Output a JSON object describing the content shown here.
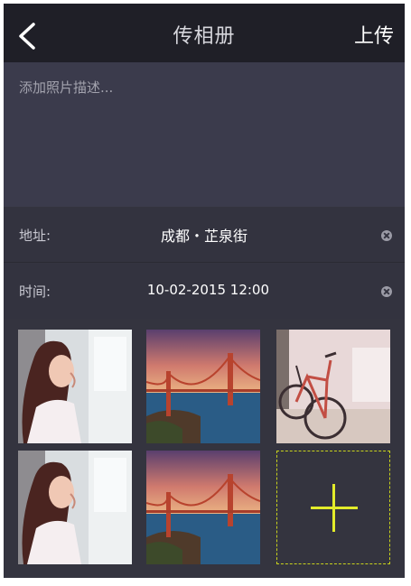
{
  "header": {
    "title": "传相册",
    "upload_label": "上传",
    "back_icon": "back-chevron-icon"
  },
  "description": {
    "placeholder": "添加照片描述..."
  },
  "fields": {
    "address": {
      "label": "地址:",
      "value": "成都・芷泉街",
      "clear_icon": "clear-icon"
    },
    "time": {
      "label": "时间:",
      "value": "10-02-2015  12:00",
      "clear_icon": "clear-icon"
    }
  },
  "photos": [
    {
      "subject": "woman portrait"
    },
    {
      "subject": "golden gate bridge"
    },
    {
      "subject": "bicycle"
    },
    {
      "subject": "woman portrait"
    },
    {
      "subject": "golden gate bridge"
    }
  ],
  "add_photo": {
    "icon": "plus-icon",
    "accent": "#e3ec2a"
  },
  "colors": {
    "header_bg": "#1f1f27",
    "body_bg": "#34343f",
    "accent": "#e3ec2a"
  }
}
